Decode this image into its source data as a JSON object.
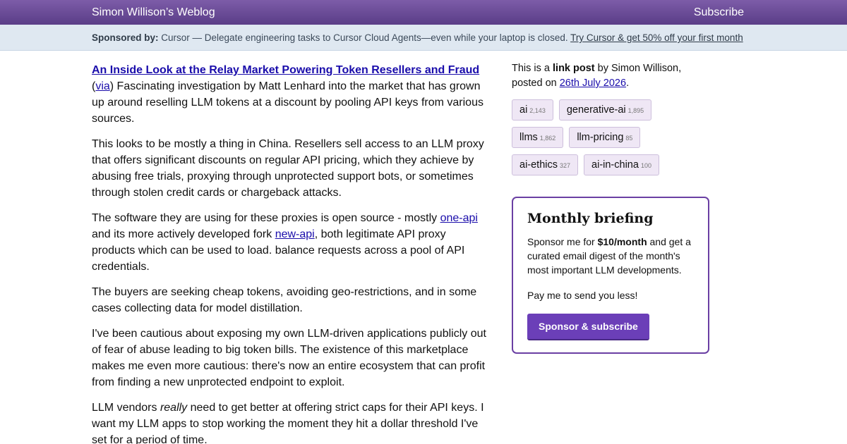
{
  "header": {
    "site_title": "Simon Willison’s Weblog",
    "subscribe_label": "Subscribe"
  },
  "sponsor_bar": {
    "prefix": "Sponsored by:",
    "text": "Cursor — Delegate engineering tasks to Cursor Cloud Agents—even while your laptop is closed.",
    "link_text": "Try Cursor & get 50% off your first month"
  },
  "post": {
    "title": "An Inside Look at the Relay Market Powering Token Resellers and Fraud",
    "via_label": "via",
    "intro": ") Fascinating investigation by Matt Lenhard into the market that has grown up around reselling LLM tokens at a discount by pooling API keys from various sources.",
    "p2": "This looks to be mostly a thing in China. Resellers sell access to an LLM proxy that offers significant discounts on regular API pricing, which they achieve by abusing free trials, proxying through unprotected support bots, or sometimes through stolen credit cards or chargeback attacks.",
    "p3_a": "The software they are using for these proxies is open source - mostly ",
    "p3_link1": "one-api",
    "p3_b": " and its more actively developed fork ",
    "p3_link2": "new-api",
    "p3_c": ", both legitimate API proxy products which can be used to load. balance requests across a pool of API credentials.",
    "p4": "The buyers are seeking cheap tokens, avoiding geo-restrictions, and in some cases collecting data for model distillation.",
    "p5": "I've been cautious about exposing my own LLM-driven applications publicly out of fear of abuse leading to big token bills. The existence of this marketplace makes me even more cautious: there's now an entire ecosystem that can profit from finding a new unprotected endpoint to exploit.",
    "p6_a": "LLM vendors ",
    "p6_em": "really",
    "p6_b": " need to get better at offering strict caps for their API keys. I want my LLM apps to stop working the moment they hit a dollar threshold I've set for a period of time."
  },
  "sidebar": {
    "meta_a": "This is a ",
    "meta_bold": "link post",
    "meta_b": " by Simon Willison, posted on ",
    "meta_date": "26th July 2026",
    "meta_end": ".",
    "tags": [
      {
        "name": "ai",
        "count": "2,143"
      },
      {
        "name": "generative-ai",
        "count": "1,895"
      },
      {
        "name": "llms",
        "count": "1,862"
      },
      {
        "name": "llm-pricing",
        "count": "85"
      },
      {
        "name": "ai-ethics",
        "count": "327"
      },
      {
        "name": "ai-in-china",
        "count": "100"
      }
    ]
  },
  "briefing": {
    "title": "Monthly briefing",
    "desc_a": "Sponsor me for ",
    "desc_bold": "$10/month",
    "desc_b": " and get a curated email digest of the month's most important LLM developments.",
    "less": "Pay me to send you less!",
    "button_label": "Sponsor & subscribe"
  }
}
